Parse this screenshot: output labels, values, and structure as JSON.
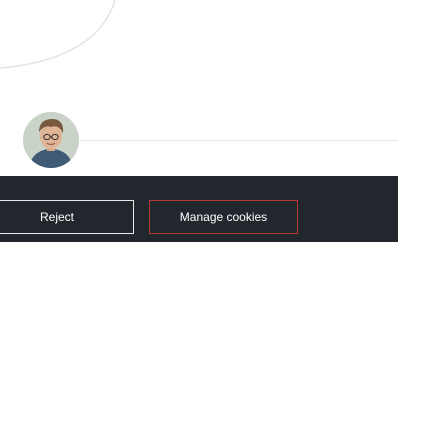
{
  "cookie_bar": {
    "reject_label": "Reject",
    "manage_label": "Manage cookies"
  },
  "colors": {
    "bar_background": "#22262d",
    "manage_border": "#b53a3a",
    "reject_border": "#e9e9e9",
    "page_background": "#ffffff"
  },
  "icons": {
    "avatar": "user-avatar-photo"
  }
}
